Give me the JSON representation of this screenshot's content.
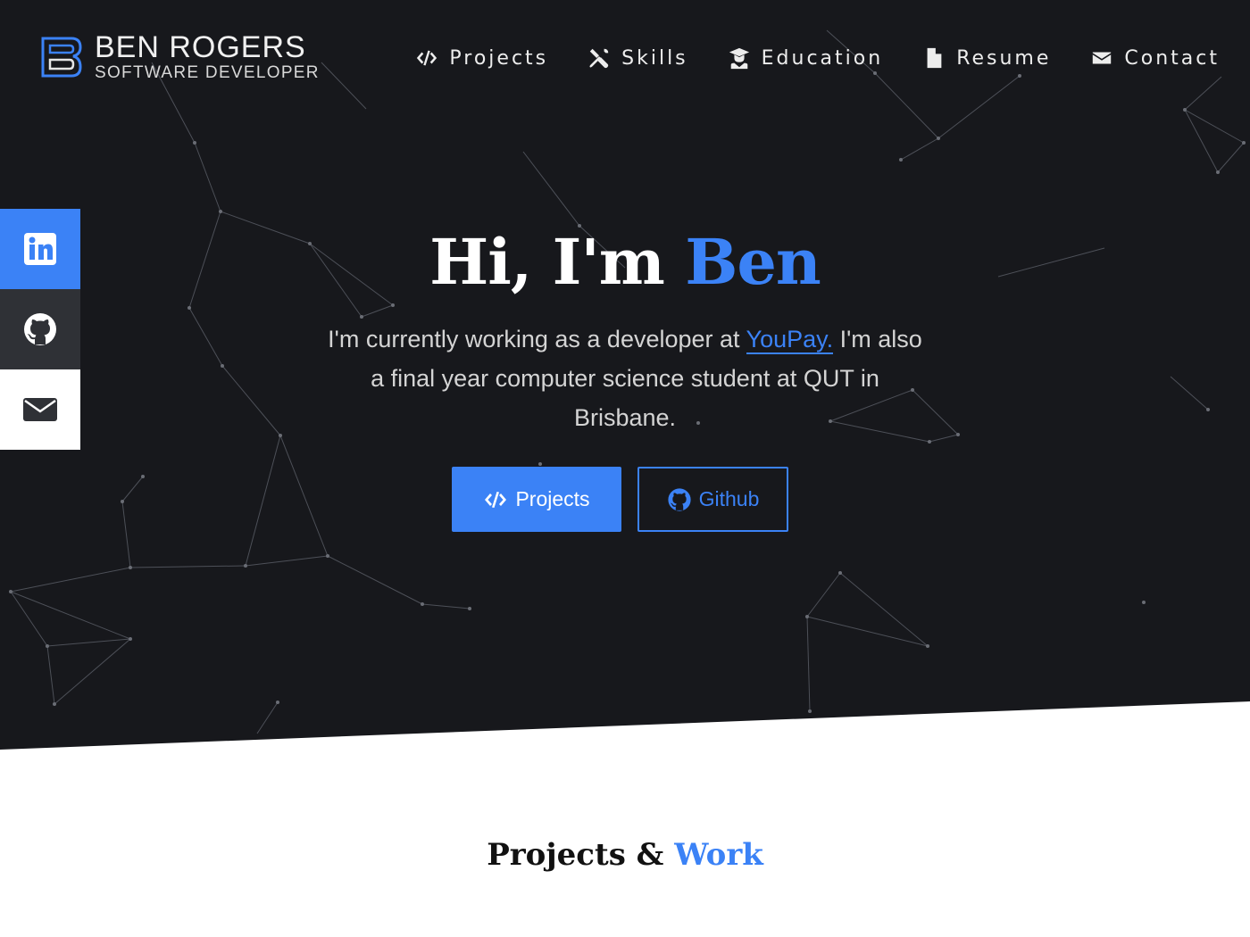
{
  "brand": {
    "name": "BEN ROGERS",
    "subtitle": "SOFTWARE DEVELOPER"
  },
  "nav": {
    "items": [
      {
        "label": "Projects",
        "icon": "code-icon"
      },
      {
        "label": "Skills",
        "icon": "tools-icon"
      },
      {
        "label": "Education",
        "icon": "graduate-icon"
      },
      {
        "label": "Resume",
        "icon": "file-icon"
      },
      {
        "label": "Contact",
        "icon": "envelope-icon"
      }
    ]
  },
  "social": [
    {
      "name": "linkedin",
      "icon": "linkedin-icon"
    },
    {
      "name": "github",
      "icon": "github-icon"
    },
    {
      "name": "email",
      "icon": "envelope-icon"
    }
  ],
  "hero": {
    "greeting": "Hi, I'm",
    "name": "Ben",
    "intro_before": "I'm currently working as a developer at ",
    "company": "YouPay.",
    "intro_after": " I'm also a final year computer science student at QUT in Brisbane."
  },
  "buttons": {
    "projects": "Projects",
    "github": "Github"
  },
  "section": {
    "title_main": "Projects &",
    "title_accent": "Work"
  },
  "colors": {
    "accent": "#3b82f6",
    "hero_bg": "#17181c",
    "page_bg": "#ffffff"
  }
}
